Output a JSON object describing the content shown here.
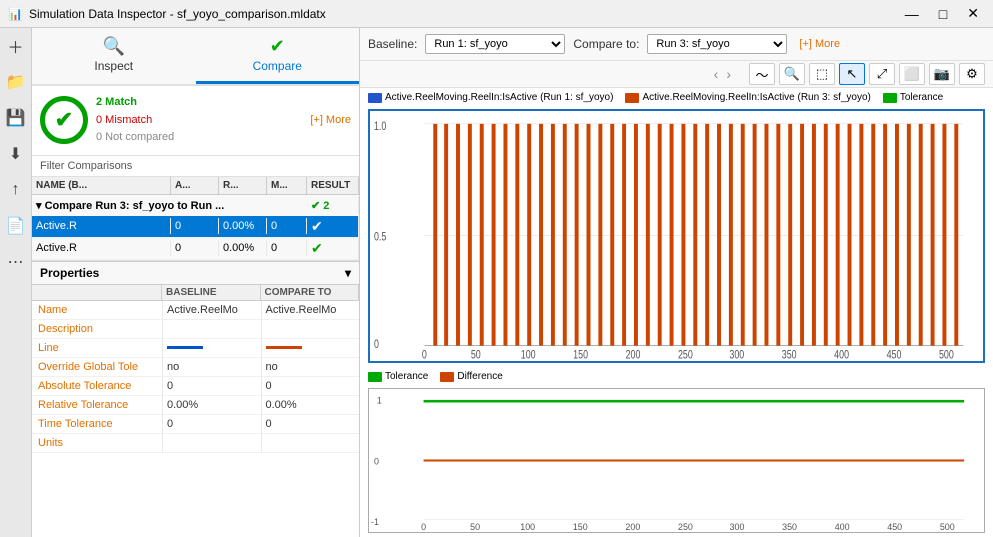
{
  "window": {
    "title": "Simulation Data Inspector - sf_yoyo_comparison.mldatx"
  },
  "tabs": [
    {
      "id": "inspect",
      "label": "Inspect",
      "icon": "🔍",
      "active": false
    },
    {
      "id": "compare",
      "label": "Compare",
      "icon": "✔",
      "active": true
    }
  ],
  "match_summary": {
    "match_count": "2 Match",
    "mismatch_count": "0 Mismatch",
    "not_compared": "0 Not compared",
    "more_label": "[+] More"
  },
  "filter_label": "Filter Comparisons",
  "table_headers": {
    "name": "NAME (B...",
    "a": "A...",
    "r": "R...",
    "m": "M...",
    "result": "RESULT"
  },
  "compare_group": {
    "label": "▾ Compare Run 3: sf_yoyo to Run ...",
    "result_count": "✔ 2",
    "rows": [
      {
        "name": "Active.R",
        "a": "0",
        "r": "0.00%",
        "m": "0",
        "result": "✔",
        "selected": true
      },
      {
        "name": "Active.R",
        "a": "0",
        "r": "0.00%",
        "m": "0",
        "result": "✔",
        "selected": false
      }
    ]
  },
  "properties": {
    "title": "Properties",
    "col_baseline": "BASELINE",
    "col_compare": "COMPARE TO",
    "rows": [
      {
        "label": "Name",
        "baseline": "Active.ReelMo",
        "compare": "Active.ReelMo"
      },
      {
        "label": "Description",
        "baseline": "",
        "compare": ""
      },
      {
        "label": "Line",
        "baseline": "line-blue",
        "compare": "line-orange"
      },
      {
        "label": "Override Global Tole",
        "baseline": "no",
        "compare": "no"
      },
      {
        "label": "Absolute Tolerance",
        "baseline": "0",
        "compare": "0"
      },
      {
        "label": "Relative Tolerance",
        "baseline": "0.00%",
        "compare": "0.00%"
      },
      {
        "label": "Time Tolerance",
        "baseline": "0",
        "compare": "0"
      },
      {
        "label": "Units",
        "baseline": "",
        "compare": ""
      }
    ]
  },
  "top_bar": {
    "baseline_label": "Baseline:",
    "baseline_value": "Run 1: sf_yoyo",
    "compare_label": "Compare to:",
    "compare_value": "Run 3: sf_yoyo",
    "more_label": "[+] More"
  },
  "chart_toolbar": {
    "nav_prev": "‹",
    "nav_next": "›",
    "tools": [
      "〜",
      "🔍",
      "⬚",
      "↖",
      "⤢",
      "⬜",
      "📷",
      "⚙"
    ]
  },
  "upper_chart": {
    "legend": [
      {
        "color": "#2255cc",
        "label": "Active.ReelMoving.ReelIn:IsActive (Run 1: sf_yoyo)"
      },
      {
        "color": "#cc4400",
        "label": "Active.ReelMoving.ReelIn:IsActive (Run 3: sf_yoyo)"
      },
      {
        "color": "#00aa00",
        "label": "Tolerance"
      }
    ],
    "x_ticks": [
      0,
      50,
      100,
      150,
      200,
      250,
      300,
      350,
      400,
      450,
      500
    ],
    "y_ticks": [
      0,
      0.5,
      1.0
    ],
    "x_max": 500,
    "y_min": 0,
    "y_max": 1.0
  },
  "lower_chart": {
    "legend": [
      {
        "color": "#00aa00",
        "label": "Tolerance"
      },
      {
        "color": "#cc4400",
        "label": "Difference"
      }
    ],
    "x_ticks": [
      0,
      50,
      100,
      150,
      200,
      250,
      300,
      350,
      400,
      450,
      500
    ],
    "y_ticks": [
      -1,
      0,
      1
    ],
    "x_max": 500,
    "y_min": -1,
    "y_max": 1
  }
}
